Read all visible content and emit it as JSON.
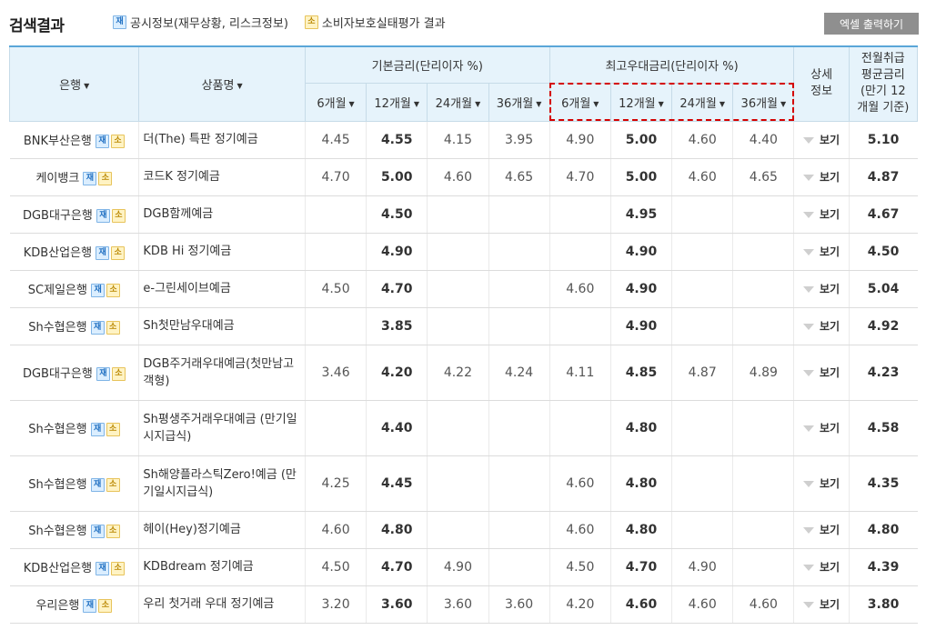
{
  "header": {
    "title": "검색결과",
    "legend_jae_badge": "재",
    "legend_jae_label": "공시정보(재무상황, 리스크정보)",
    "legend_so_badge": "소",
    "legend_so_label": "소비자보호실태평가 결과",
    "excel_button": "엑셀 출력하기"
  },
  "table": {
    "col_bank": "은행",
    "col_product": "상품명",
    "group_basic": "기본금리(단리이자 %)",
    "group_max": "최고우대금리(단리이자 %)",
    "col_detail": "상세 정보",
    "col_avg": "전월취급 평균금리 (만기 12 개월 기준)",
    "terms": [
      "6개월",
      "12개월",
      "24개월",
      "36개월"
    ],
    "sort_arrow": "▼",
    "detail_label": "보기",
    "rows": [
      {
        "bank": "BNK부산은행",
        "product": "더(The) 특판 정기예금",
        "b6": "4.45",
        "b12": "4.55",
        "b24": "4.15",
        "b36": "3.95",
        "m6": "4.90",
        "m12": "5.00",
        "m24": "4.60",
        "m36": "4.40",
        "avg": "5.10"
      },
      {
        "bank": "케이뱅크",
        "product": "코드K 정기예금",
        "b6": "4.70",
        "b12": "5.00",
        "b24": "4.60",
        "b36": "4.65",
        "m6": "4.70",
        "m12": "5.00",
        "m24": "4.60",
        "m36": "4.65",
        "avg": "4.87"
      },
      {
        "bank": "DGB대구은행",
        "product": "DGB함께예금",
        "b6": "",
        "b12": "4.50",
        "b24": "",
        "b36": "",
        "m6": "",
        "m12": "4.95",
        "m24": "",
        "m36": "",
        "avg": "4.67"
      },
      {
        "bank": "KDB산업은행",
        "product": "KDB Hi 정기예금",
        "b6": "",
        "b12": "4.90",
        "b24": "",
        "b36": "",
        "m6": "",
        "m12": "4.90",
        "m24": "",
        "m36": "",
        "avg": "4.50"
      },
      {
        "bank": "SC제일은행",
        "product": "e-그린세이브예금",
        "b6": "4.50",
        "b12": "4.70",
        "b24": "",
        "b36": "",
        "m6": "4.60",
        "m12": "4.90",
        "m24": "",
        "m36": "",
        "avg": "5.04"
      },
      {
        "bank": "Sh수협은행",
        "product": "Sh첫만남우대예금",
        "b6": "",
        "b12": "3.85",
        "b24": "",
        "b36": "",
        "m6": "",
        "m12": "4.90",
        "m24": "",
        "m36": "",
        "avg": "4.92"
      },
      {
        "bank": "DGB대구은행",
        "product": "DGB주거래우대예금(첫만남고객형)",
        "b6": "3.46",
        "b12": "4.20",
        "b24": "4.22",
        "b36": "4.24",
        "m6": "4.11",
        "m12": "4.85",
        "m24": "4.87",
        "m36": "4.89",
        "avg": "4.23"
      },
      {
        "bank": "Sh수협은행",
        "product": "Sh평생주거래우대예금 (만기일시지급식)",
        "b6": "",
        "b12": "4.40",
        "b24": "",
        "b36": "",
        "m6": "",
        "m12": "4.80",
        "m24": "",
        "m36": "",
        "avg": "4.58"
      },
      {
        "bank": "Sh수협은행",
        "product": "Sh해양플라스틱Zero!예금 (만기일시지급식)",
        "b6": "4.25",
        "b12": "4.45",
        "b24": "",
        "b36": "",
        "m6": "4.60",
        "m12": "4.80",
        "m24": "",
        "m36": "",
        "avg": "4.35"
      },
      {
        "bank": "Sh수협은행",
        "product": "헤이(Hey)정기예금",
        "b6": "4.60",
        "b12": "4.80",
        "b24": "",
        "b36": "",
        "m6": "4.60",
        "m12": "4.80",
        "m24": "",
        "m36": "",
        "avg": "4.80"
      },
      {
        "bank": "KDB산업은행",
        "product": "KDBdream 정기예금",
        "b6": "4.50",
        "b12": "4.70",
        "b24": "4.90",
        "b36": "",
        "m6": "4.50",
        "m12": "4.70",
        "m24": "4.90",
        "m36": "",
        "avg": "4.39"
      },
      {
        "bank": "우리은행",
        "product": "우리 첫거래 우대 정기예금",
        "b6": "3.20",
        "b12": "3.60",
        "b24": "3.60",
        "b36": "3.60",
        "m6": "4.20",
        "m12": "4.60",
        "m24": "4.60",
        "m36": "4.60",
        "avg": "3.80"
      }
    ]
  },
  "colors": {
    "header_bg": "#e6f3fb",
    "accent_border": "#5aa6d8",
    "highlight_dash": "#d40000",
    "excel_btn": "#8f8f8f"
  }
}
